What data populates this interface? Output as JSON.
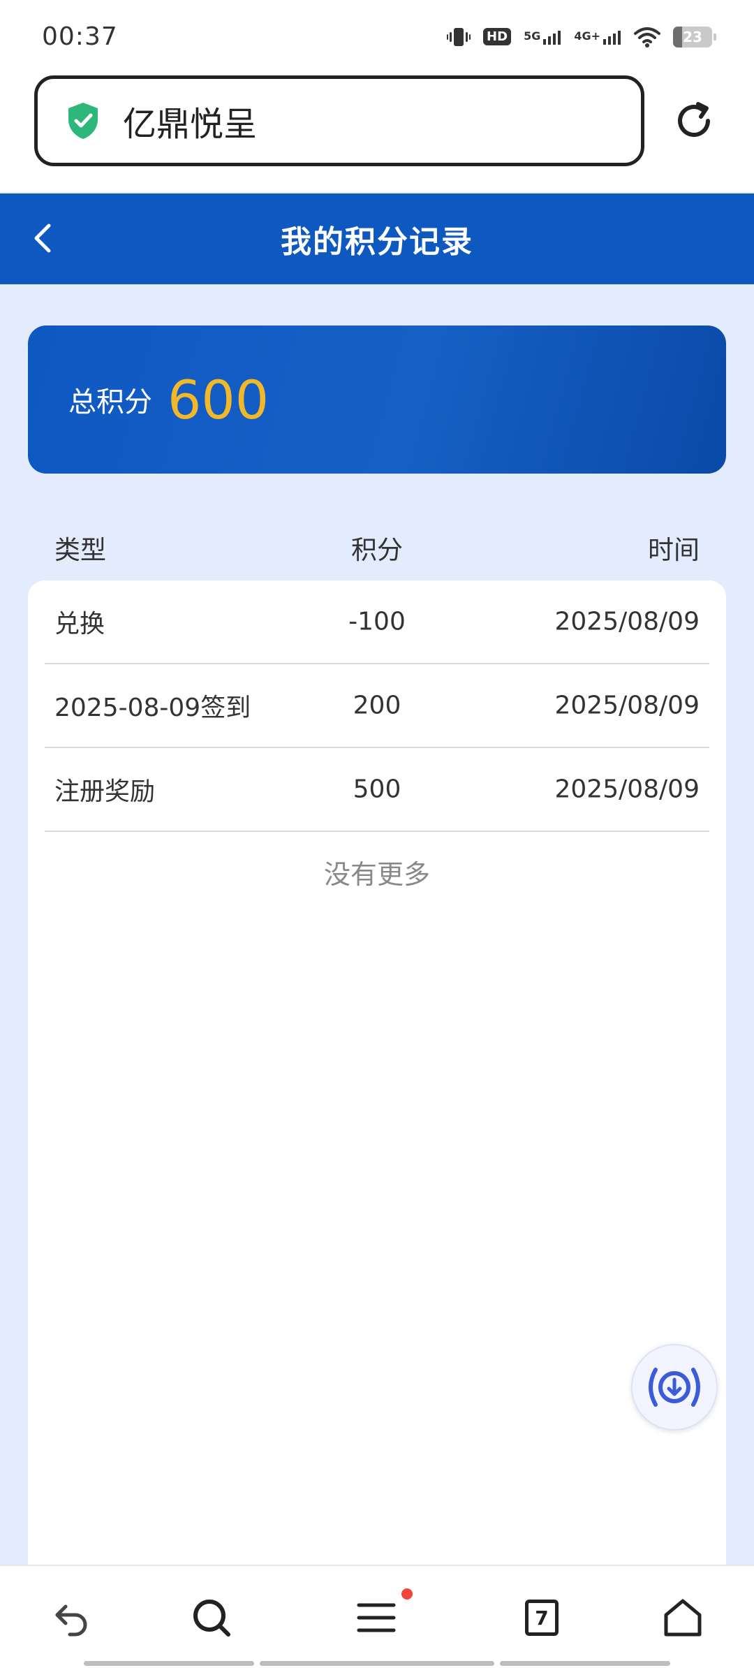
{
  "status_bar": {
    "time": "00:37",
    "hd_label": "HD",
    "network_1": "5G",
    "network_2": "4G+",
    "battery": "23",
    "battery_level": 0.23
  },
  "browser": {
    "address_text": "亿鼎悦呈",
    "icons": [
      "shield-check-icon",
      "reload-icon"
    ],
    "tab_count": "7"
  },
  "header": {
    "title": "我的积分记录"
  },
  "summary": {
    "label": "总积分",
    "value": "600"
  },
  "table": {
    "headers": {
      "type": "类型",
      "points": "积分",
      "time": "时间"
    },
    "rows": [
      {
        "type": "兑换",
        "points": "-100",
        "time": "2025/08/09"
      },
      {
        "type": "2025-08-09签到",
        "points": "200",
        "time": "2025/08/09"
      },
      {
        "type": "注册奖励",
        "points": "500",
        "time": "2025/08/09"
      }
    ],
    "footer": "没有更多"
  },
  "colors": {
    "header_blue": "#0d59c0",
    "points_gold": "#f2b829",
    "page_bg": "#e3ecfd",
    "shield_green": "#2db77a"
  }
}
